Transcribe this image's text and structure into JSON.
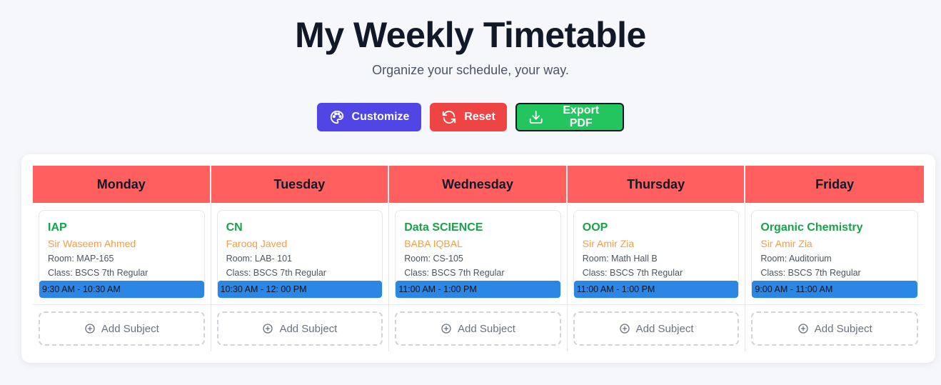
{
  "header": {
    "title": "My Weekly Timetable",
    "subtitle": "Organize your schedule, your way."
  },
  "actions": {
    "customize_label": "Customize",
    "reset_label": "Reset",
    "export_label": "Export PDF"
  },
  "colors": {
    "header_bg": "#ff5f5f",
    "customize": "#4f46e5",
    "reset": "#ef4444",
    "export": "#22c55e",
    "subject": "#16a34a",
    "teacher": "#f59e42",
    "time_bar": "#2b87e3"
  },
  "icons": {
    "customize": "palette-icon",
    "reset": "refresh-icon",
    "export": "download-icon",
    "add": "plus-circle-icon"
  },
  "days": [
    {
      "day": "Monday",
      "entry": {
        "subject": "IAP",
        "teacher": "Sir Waseem Ahmed",
        "room": "Room: MAP-165",
        "class": "Class: BSCS 7th Regular",
        "time": "9:30 AM - 10:30 AM"
      },
      "add_label": "Add Subject"
    },
    {
      "day": "Tuesday",
      "entry": {
        "subject": "CN",
        "teacher": "Farooq Javed",
        "room": "Room: LAB- 101",
        "class": "Class: BSCS 7th Regular",
        "time": "10:30 AM - 12: 00 PM"
      },
      "add_label": "Add Subject"
    },
    {
      "day": "Wednesday",
      "entry": {
        "subject": "Data SCIENCE",
        "teacher": "BABA IQBAL",
        "room": "Room: CS-105",
        "class": "Class: BSCS 7th Regular",
        "time": "11:00 AM - 1:00 PM"
      },
      "add_label": "Add Subject"
    },
    {
      "day": "Thursday",
      "entry": {
        "subject": "OOP",
        "teacher": "Sir Amir Zia",
        "room": "Room: Math Hall B",
        "class": "Class: BSCS 7th Regular",
        "time": "11:00 AM - 1:00 PM"
      },
      "add_label": "Add Subject"
    },
    {
      "day": "Friday",
      "entry": {
        "subject": "Organic Chemistry",
        "teacher": "Sir Amir Zia",
        "room": "Room: Auditorium",
        "class": "Class: BSCS 7th Regular",
        "time": "9:00 AM - 11:00 AM"
      },
      "add_label": "Add Subject"
    }
  ]
}
